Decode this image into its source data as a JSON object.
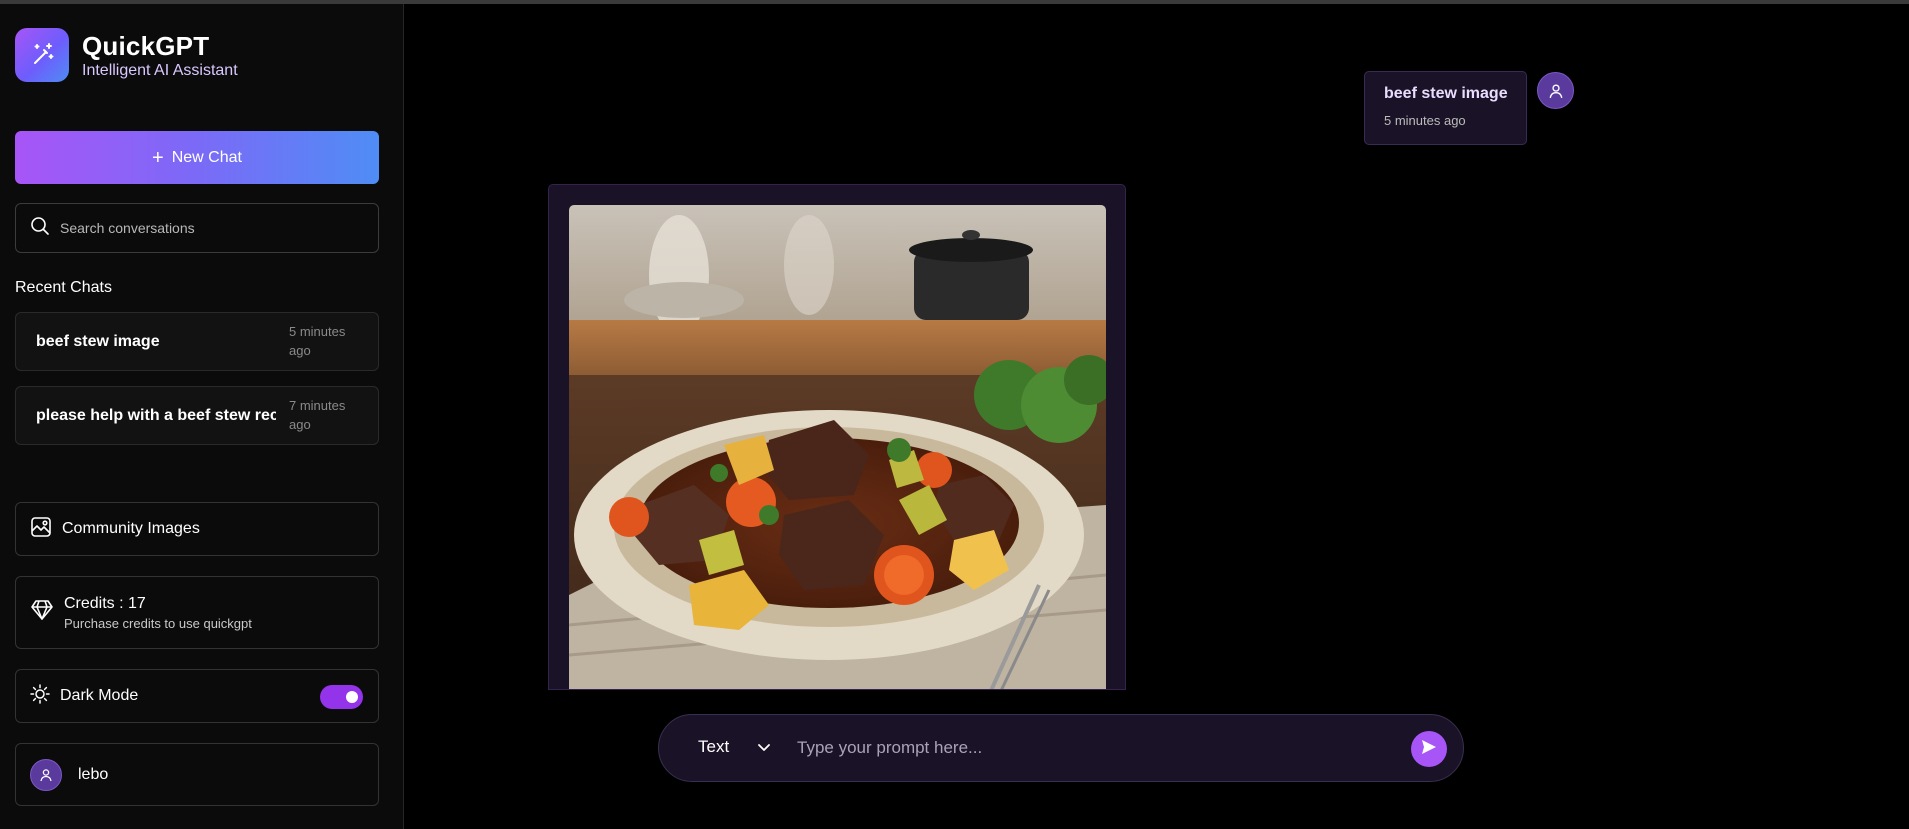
{
  "app": {
    "name": "QuickGPT",
    "tagline": "Intelligent AI Assistant"
  },
  "sidebar": {
    "new_chat_label": "New Chat",
    "search_placeholder": "Search conversations",
    "recent_title": "Recent Chats",
    "recent_chats": [
      {
        "label": "beef stew image",
        "time": "5 minutes ago"
      },
      {
        "label": "please help with a beef stew rec",
        "time": "7 minutes ago"
      }
    ],
    "community_label": "Community Images",
    "credits_title": "Credits : 17",
    "credits_sub": "Purchase credits to use quickgpt",
    "dark_mode_label": "Dark Mode",
    "dark_mode_on": true,
    "user_name": "lebo"
  },
  "conversation": {
    "user_message": "beef stew image",
    "user_message_time": "5 minutes ago",
    "image_icon": "beef-stew-image"
  },
  "prompt": {
    "mode_label": "Text",
    "placeholder": "Type your prompt here..."
  },
  "colors": {
    "accent": "#a855f7",
    "gradient_end": "#4f8df5",
    "bubble_bg": "#1a1226"
  }
}
